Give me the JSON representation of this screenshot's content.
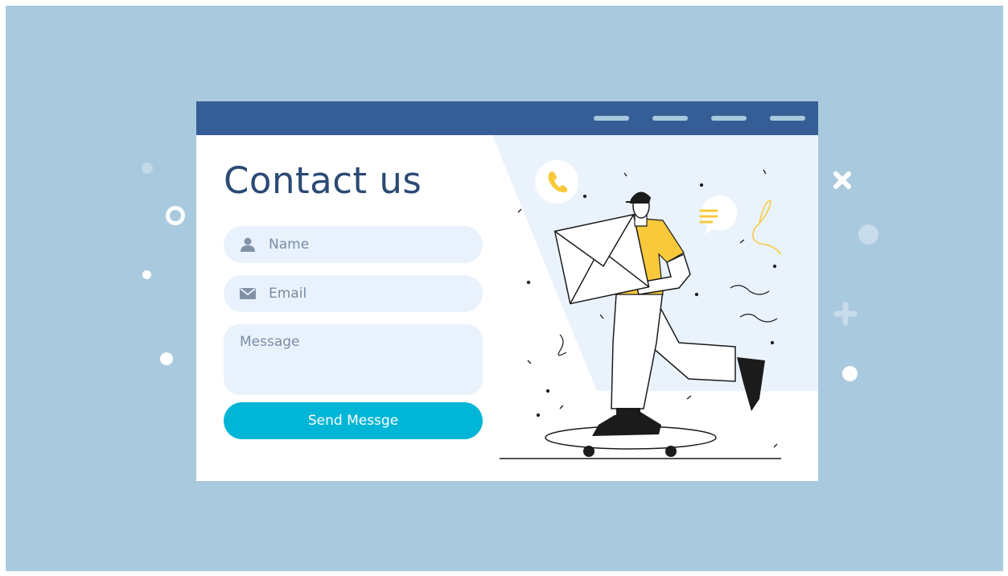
{
  "page": {
    "title": "Contact us"
  },
  "form": {
    "name_placeholder": "Name",
    "email_placeholder": "Email",
    "message_placeholder": "Message",
    "send_label": "Send Messge"
  },
  "colors": {
    "background": "#a9c9de",
    "header_bar": "#365e96",
    "title_text": "#2b4a74",
    "field_fill": "#e9f2fc",
    "send_button": "#00b5d6",
    "accent_yellow": "#f9c93c",
    "illustration_panel": "#eaf3fc"
  },
  "icons": {
    "name_field": "user-icon",
    "email_field": "envelope-icon",
    "phone_bubble": "phone-icon",
    "chat_bubble": "chat-icon"
  }
}
